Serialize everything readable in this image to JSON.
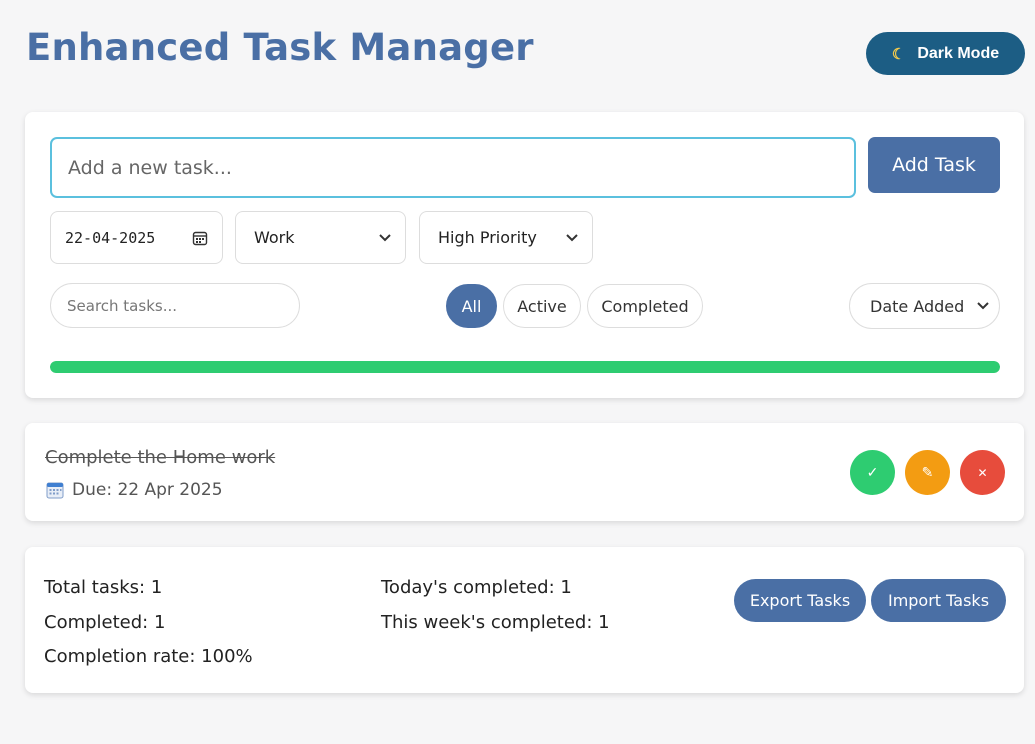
{
  "header": {
    "title": "Enhanced Task Manager",
    "dark_mode_label": "Dark Mode",
    "dark_mode_icon": "moon-icon"
  },
  "form": {
    "task_placeholder": "Add a new task...",
    "add_label": "Add Task",
    "date_value": "22-04-2025",
    "date_icon": "calendar-icon",
    "category_value": "Work",
    "priority_value": "High Priority"
  },
  "filters": {
    "search_placeholder": "Search tasks...",
    "all_label": "All",
    "active_label": "Active",
    "completed_label": "Completed",
    "active_filter": "All",
    "sort_value": "Date Added"
  },
  "progress": {
    "percent": 100,
    "color": "#2ecc71"
  },
  "tasks": [
    {
      "text": "Complete the Home work",
      "due": "Due: 22 Apr 2025",
      "completed": true,
      "complete_icon": "✓",
      "edit_icon": "✎",
      "delete_icon": "✕"
    }
  ],
  "stats": {
    "total": "Total tasks: 1",
    "completed": "Completed: 1",
    "rate": "Completion rate: 100%",
    "today": "Today's completed: 1",
    "week": "This week's completed: 1"
  },
  "io": {
    "export_label": "Export Tasks",
    "import_label": "Import Tasks"
  },
  "colors": {
    "accent": "#4a6fa5",
    "dark_mode_button": "#1c5d84",
    "success": "#2ecc71",
    "warning": "#f39c12",
    "danger": "#e74c3c",
    "input_focus": "#5bc0de"
  }
}
